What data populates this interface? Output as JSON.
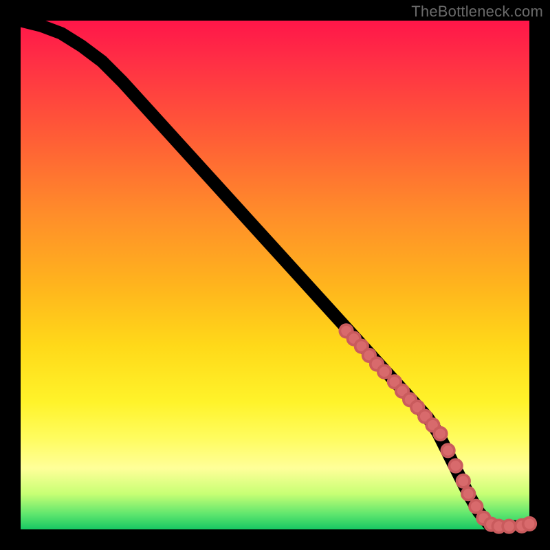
{
  "watermark": "TheBottleneck.com",
  "chart_data": {
    "type": "line",
    "title": "",
    "xlabel": "",
    "ylabel": "",
    "xlim": [
      0,
      100
    ],
    "ylim": [
      0,
      100
    ],
    "grid": false,
    "curve": {
      "name": "bottleneck-curve",
      "x": [
        0,
        4,
        8,
        12,
        16,
        20,
        30,
        40,
        50,
        60,
        70,
        75,
        80,
        82,
        84,
        86,
        88,
        90,
        92,
        94,
        96,
        98,
        100
      ],
      "y": [
        100,
        99,
        97.5,
        95,
        92,
        88,
        77,
        66,
        55,
        44,
        33,
        27.5,
        22,
        19,
        15,
        11,
        7,
        3.5,
        1,
        0.5,
        0.5,
        0.6,
        1.2
      ]
    },
    "scatter_points": {
      "name": "highlighted-segment",
      "x": [
        64,
        65.5,
        67,
        68.5,
        70,
        71.5,
        73.5,
        75,
        76.5,
        78,
        79.5,
        81,
        82.5,
        84,
        85.5,
        87,
        88,
        89.5,
        91,
        92.5,
        94,
        96,
        98.5,
        100
      ],
      "y": [
        39,
        37.5,
        36,
        34.2,
        32.5,
        31,
        29,
        27.2,
        25.5,
        24,
        22.2,
        20.5,
        18.8,
        15.5,
        12.5,
        9.5,
        7,
        4.5,
        2.2,
        1,
        0.6,
        0.6,
        0.7,
        1.1
      ]
    },
    "background_gradient": {
      "direction": "vertical",
      "stops": [
        {
          "pos": 0.0,
          "color": "#ff1649"
        },
        {
          "pos": 0.08,
          "color": "#ff2f45"
        },
        {
          "pos": 0.22,
          "color": "#ff5a37"
        },
        {
          "pos": 0.38,
          "color": "#ff8d2a"
        },
        {
          "pos": 0.52,
          "color": "#ffb41d"
        },
        {
          "pos": 0.64,
          "color": "#ffd919"
        },
        {
          "pos": 0.75,
          "color": "#fff32a"
        },
        {
          "pos": 0.82,
          "color": "#fffc5e"
        },
        {
          "pos": 0.88,
          "color": "#ffff99"
        },
        {
          "pos": 0.93,
          "color": "#c8ff74"
        },
        {
          "pos": 0.97,
          "color": "#5fe66e"
        },
        {
          "pos": 1.0,
          "color": "#17c763"
        }
      ]
    }
  }
}
